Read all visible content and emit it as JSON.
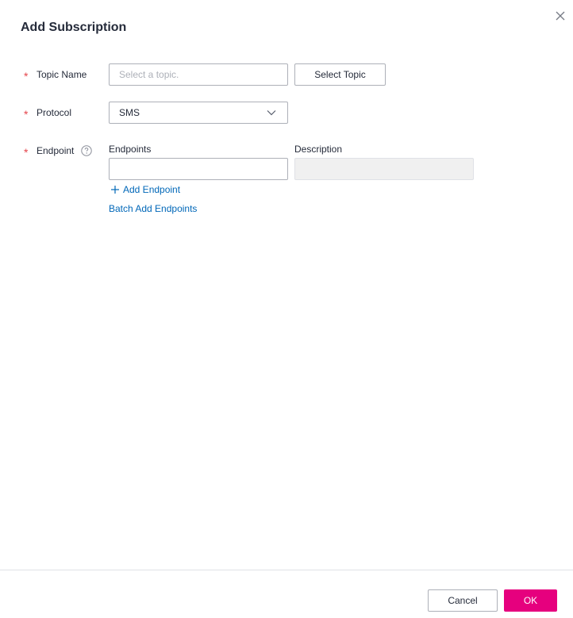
{
  "dialog": {
    "title": "Add Subscription",
    "close_icon": "close-icon"
  },
  "form": {
    "topic": {
      "label": "Topic Name",
      "required": true,
      "placeholder": "Select a topic.",
      "value": "",
      "select_button": "Select Topic"
    },
    "protocol": {
      "label": "Protocol",
      "required": true,
      "selected": "SMS",
      "icon": "chevron-down-icon"
    },
    "endpoint": {
      "label": "Endpoint",
      "required": true,
      "help_icon": "question-circle-icon",
      "columns": [
        "Endpoints",
        "Description"
      ],
      "rows": [
        {
          "endpoint": "",
          "description": ""
        }
      ],
      "add_link": "Add Endpoint",
      "add_icon": "plus-icon",
      "batch_link": "Batch Add Endpoints"
    }
  },
  "footer": {
    "cancel": "Cancel",
    "ok": "OK"
  },
  "colors": {
    "required_asterisk": "#e5444b",
    "link": "#0067b8",
    "primary_button": "#e6007e",
    "text": "#252b3a",
    "border": "#adb0b8"
  }
}
